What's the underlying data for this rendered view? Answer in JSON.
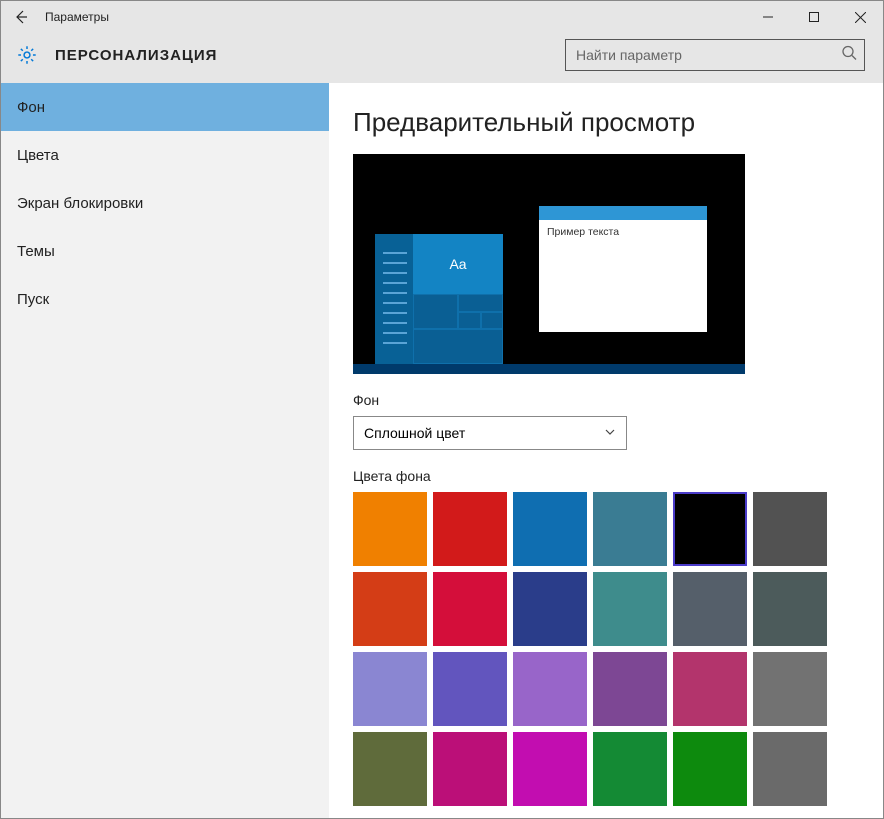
{
  "titlebar": {
    "title": "Параметры"
  },
  "header": {
    "title": "ПЕРСОНАЛИЗАЦИЯ",
    "search_placeholder": "Найти параметр"
  },
  "sidebar": {
    "items": [
      {
        "label": "Фон",
        "active": true
      },
      {
        "label": "Цвета",
        "active": false
      },
      {
        "label": "Экран блокировки",
        "active": false
      },
      {
        "label": "Темы",
        "active": false
      },
      {
        "label": "Пуск",
        "active": false
      }
    ]
  },
  "content": {
    "preview_heading": "Предварительный просмотр",
    "preview_tile_text": "Aa",
    "preview_sample_text": "Пример текста",
    "background_label": "Фон",
    "background_value": "Сплошной цвет",
    "colors_label": "Цвета фона",
    "colors": [
      "#f08000",
      "#d21a1a",
      "#0f6eb1",
      "#3a7c93",
      "#000000",
      "#525252",
      "#d43d16",
      "#d40e3a",
      "#2a3d8a",
      "#3e8c8c",
      "#555f6a",
      "#4c5b5b",
      "#8a86d2",
      "#6255be",
      "#9865c9",
      "#7d4794",
      "#b3346c",
      "#727272",
      "#5f6b3b",
      "#bb0f78",
      "#c20db0",
      "#148a34",
      "#0d8a0d",
      "#6a6a6a"
    ],
    "selected_color_index": 4
  }
}
